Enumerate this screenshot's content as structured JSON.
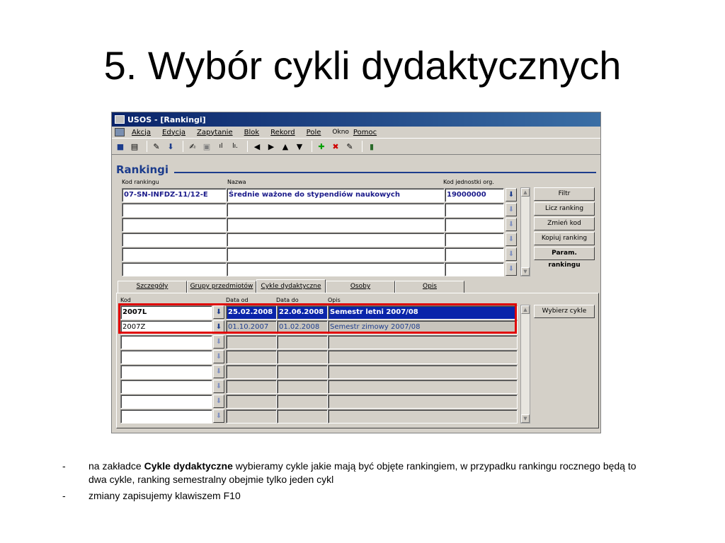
{
  "slide": {
    "title": "5. Wybór cykli dydaktycznych",
    "bullet1_pre": "na zakładce ",
    "bullet1_bold": "Cykle dydaktyczne",
    "bullet1_post": " wybieramy cykle jakie mają być objęte rankingiem, w przypadku rankingu rocznego będą to dwa cykle, ranking semestralny obejmie tylko jeden cykl",
    "bullet2": "zmiany zapisujemy klawiszem F10",
    "dash": "-"
  },
  "window": {
    "title": "USOS - [Rankingi]",
    "menu": [
      "Akcja",
      "Edycja",
      "Zapytanie",
      "Blok",
      "Rekord",
      "Pole",
      "Okno",
      "Pomoc"
    ]
  },
  "rankingi": {
    "section_title": "Rankingi",
    "col_kod": "Kod rankingu",
    "col_nazwa": "Nazwa",
    "col_jedn": "Kod jednostki org.",
    "row1_kod": "07-SN-INFDZ-11/12-E",
    "row1_nazwa": "Średnie ważone do stypendiów naukowych",
    "row1_jedn": "19000000",
    "buttons": [
      "Filtr",
      "Licz ranking",
      "Zmień kod",
      "Kopiuj ranking",
      "Param. rankingu"
    ]
  },
  "tabs": [
    "Szczegóły",
    "Grupy przedmiotów",
    "Cykle dydaktyczne",
    "Osoby",
    "Opis"
  ],
  "cykle": {
    "col_kod": "Kod",
    "col_od": "Data od",
    "col_do": "Data do",
    "col_opis": "Opis",
    "rows": [
      {
        "kod": "2007L",
        "od": "25.02.2008",
        "do": "22.06.2008",
        "opis": "Semestr letni 2007/08"
      },
      {
        "kod": "2007Z",
        "od": "01.10.2007",
        "do": "01.02.2008",
        "opis": "Semestr zimowy 2007/08"
      }
    ],
    "button": "Wybierz cykle"
  },
  "icons": {
    "lov": "lov-arrow-icon",
    "scroll_up": "scroll-up-icon",
    "scroll_down": "scroll-down-icon"
  },
  "colors": {
    "title_bar": "#0a246a",
    "selected_row": "#0a24aa",
    "highlight_box": "#e00000"
  }
}
